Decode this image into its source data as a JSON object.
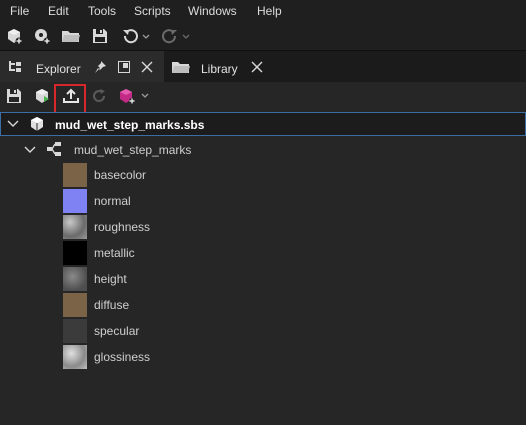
{
  "menubar": {
    "items": [
      "File",
      "Edit",
      "Tools",
      "Scripts",
      "Windows",
      "Help"
    ]
  },
  "toolbar": {
    "icons": [
      "new-substance-icon",
      "new-graph-icon",
      "open-folder-icon",
      "save-icon",
      "undo-icon",
      "redo-icon"
    ]
  },
  "tabs": {
    "explorer": "Explorer",
    "library": "Library"
  },
  "explorer_toolbar": {
    "icons": [
      "save-icon",
      "publish-icon",
      "export-icon",
      "reload-icon",
      "graph-add-icon"
    ]
  },
  "tree": {
    "package": "mud_wet_step_marks.sbs",
    "graph": "mud_wet_step_marks",
    "outputs": [
      {
        "label": "basecolor",
        "color": "#7a6346"
      },
      {
        "label": "normal",
        "color": "#7f82f2"
      },
      {
        "label": "roughness",
        "color": "#9a9a9a"
      },
      {
        "label": "metallic",
        "color": "#000000"
      },
      {
        "label": "height",
        "color": "#6e6e6e"
      },
      {
        "label": "diffuse",
        "color": "#7a6346"
      },
      {
        "label": "specular",
        "color": "#3b3b3b"
      },
      {
        "label": "glossiness",
        "color": "#bdbdbd"
      }
    ]
  },
  "colors": {
    "highlight": "#d7272b",
    "selection_border": "#3a6ea5"
  }
}
